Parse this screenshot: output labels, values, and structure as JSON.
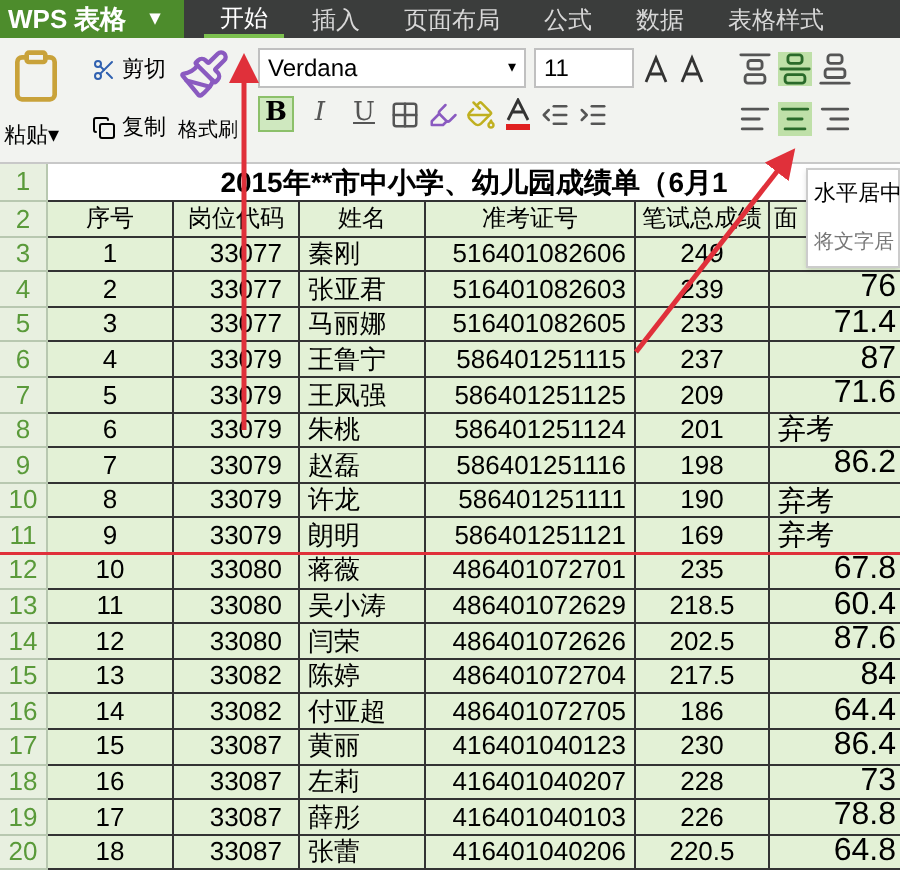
{
  "app_menu": {
    "label": "WPS 表格",
    "caret": "▾"
  },
  "tabs": [
    {
      "label": "开始",
      "selected": true
    },
    {
      "label": "插入",
      "selected": false
    },
    {
      "label": "页面布局",
      "selected": false
    },
    {
      "label": "公式",
      "selected": false
    },
    {
      "label": "数据",
      "selected": false
    },
    {
      "label": "表格样式",
      "selected": false
    }
  ],
  "ribbon": {
    "paste": {
      "label": "粘贴",
      "caret": "▾"
    },
    "cut": "剪切",
    "copy": "复制",
    "format_painter": "格式刷",
    "font": "Verdana",
    "font_caret": "▾",
    "font_size": "11",
    "format_buttons": [
      {
        "label": "B",
        "kind": "bold",
        "selected": true
      },
      {
        "label": "I",
        "kind": "italic",
        "selected": false
      },
      {
        "label": "U",
        "kind": "underline",
        "selected": false
      }
    ],
    "align_buttons": [
      {
        "kind": "top",
        "selected": false
      },
      {
        "kind": "middle",
        "selected": true
      },
      {
        "kind": "bottom",
        "selected": false
      },
      {
        "kind": "left",
        "selected": false
      },
      {
        "kind": "center",
        "selected": true
      },
      {
        "kind": "right",
        "selected": false
      }
    ]
  },
  "tooltip": {
    "title": "水平居中",
    "text": "将文字居"
  },
  "sheet": {
    "title_row": {
      "row_number": "1",
      "text": "2015年**市中小学、幼儿园成绩单（6月1"
    },
    "header_row": {
      "row_number": "2",
      "columns": [
        "序号",
        "岗位代码",
        "姓名",
        "准考证号",
        "笔试总成绩",
        "面"
      ]
    },
    "rows": [
      {
        "row_number": "3",
        "cells": [
          "1",
          "33077",
          "秦刚",
          "516401082606",
          "249"
        ]
      },
      {
        "row_number": "4",
        "cells": [
          "2",
          "33077",
          "张亚君",
          "516401082603",
          "239"
        ],
        "score": {
          "text": "76",
          "kind": "number"
        }
      },
      {
        "row_number": "5",
        "cells": [
          "3",
          "33077",
          "马丽娜",
          "516401082605",
          "233"
        ],
        "score": {
          "text": "71.4",
          "kind": "number"
        }
      },
      {
        "row_number": "6",
        "cells": [
          "4",
          "33079",
          "王鲁宁",
          "586401251115",
          "237"
        ],
        "score": {
          "text": "87",
          "kind": "number"
        }
      },
      {
        "row_number": "7",
        "cells": [
          "5",
          "33079",
          "王凤强",
          "586401251125",
          "209"
        ],
        "score": {
          "text": "71.6",
          "kind": "number"
        }
      },
      {
        "row_number": "8",
        "cells": [
          "6",
          "33079",
          "朱桃",
          "586401251124",
          "201"
        ],
        "score": {
          "text": "弃考",
          "kind": "text"
        }
      },
      {
        "row_number": "9",
        "cells": [
          "7",
          "33079",
          "赵磊",
          "586401251116",
          "198"
        ],
        "score": {
          "text": "86.2",
          "kind": "number"
        }
      },
      {
        "row_number": "10",
        "cells": [
          "8",
          "33079",
          "许龙",
          "586401251111",
          "190"
        ],
        "score": {
          "text": "弃考",
          "kind": "text"
        }
      },
      {
        "row_number": "11",
        "cells": [
          "9",
          "33079",
          "朗明",
          "586401251121",
          "169"
        ],
        "score": {
          "text": "弃考",
          "kind": "text"
        }
      },
      {
        "row_number": "12",
        "cells": [
          "10",
          "33080",
          "蒋薇",
          "486401072701",
          "235"
        ],
        "score": {
          "text": "67.8",
          "kind": "number"
        }
      },
      {
        "row_number": "13",
        "cells": [
          "11",
          "33080",
          "吴小涛",
          "486401072629",
          "218.5"
        ],
        "score": {
          "text": "60.4",
          "kind": "number"
        }
      },
      {
        "row_number": "14",
        "cells": [
          "12",
          "33080",
          "闫荣",
          "486401072626",
          "202.5"
        ],
        "score": {
          "text": "87.6",
          "kind": "number"
        }
      },
      {
        "row_number": "15",
        "cells": [
          "13",
          "33082",
          "陈婷",
          "486401072704",
          "217.5"
        ],
        "score": {
          "text": "84",
          "kind": "number"
        }
      },
      {
        "row_number": "16",
        "cells": [
          "14",
          "33082",
          "付亚超",
          "486401072705",
          "186"
        ],
        "score": {
          "text": "64.4",
          "kind": "number"
        }
      },
      {
        "row_number": "17",
        "cells": [
          "15",
          "33087",
          "黄丽",
          "416401040123",
          "230"
        ],
        "score": {
          "text": "86.4",
          "kind": "number"
        }
      },
      {
        "row_number": "18",
        "cells": [
          "16",
          "33087",
          "左莉",
          "416401040207",
          "228"
        ],
        "score": {
          "text": "73",
          "kind": "number"
        }
      },
      {
        "row_number": "19",
        "cells": [
          "17",
          "33087",
          "薛彤",
          "416401040103",
          "226"
        ],
        "score": {
          "text": "78.8",
          "kind": "number"
        }
      },
      {
        "row_number": "20",
        "cells": [
          "18",
          "33087",
          "张蕾",
          "416401040206",
          "220.5"
        ],
        "score": {
          "text": "64.8",
          "kind": "number"
        }
      }
    ]
  }
}
